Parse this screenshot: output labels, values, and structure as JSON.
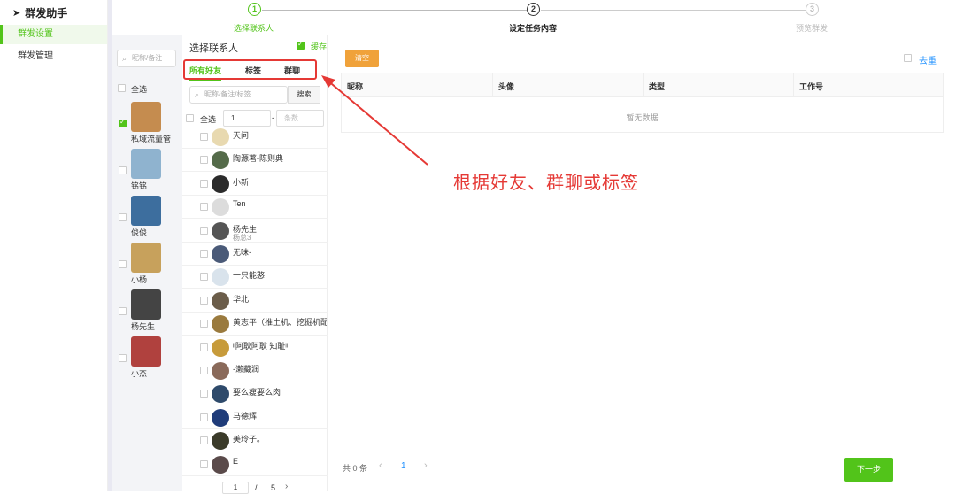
{
  "app_title": "群发助手",
  "nav": [
    {
      "label": "群发设置",
      "active": true
    },
    {
      "label": "群发管理",
      "active": false
    }
  ],
  "steps": [
    {
      "num": "1",
      "label": "选择联系人",
      "state": "active"
    },
    {
      "num": "2",
      "label": "设定任务内容",
      "state": "current"
    },
    {
      "num": "3",
      "label": "预览群发",
      "state": "pending"
    }
  ],
  "accounts": {
    "search_placeholder": "昵称/备注",
    "select_all": "全选",
    "items": [
      {
        "name": "私域流量管",
        "checked": true,
        "color": "#c58c4f"
      },
      {
        "name": "铭铭",
        "checked": false,
        "color": "#8fb3cf"
      },
      {
        "name": "俊俊",
        "checked": false,
        "color": "#3d6e9e"
      },
      {
        "name": "小杨",
        "checked": false,
        "color": "#c7a15c"
      },
      {
        "name": "杨先生",
        "checked": false,
        "color": "#444444"
      },
      {
        "name": "小杰",
        "checked": false,
        "color": "#b0413e"
      }
    ]
  },
  "contacts": {
    "header": "选择联系人",
    "cache_label": "缓存",
    "tabs": [
      "所有好友",
      "标签",
      "群聊"
    ],
    "search_placeholder": "昵称/备注/标签",
    "search_button": "搜索",
    "select_all": "全选",
    "range_from": "1",
    "range_to_placeholder": "条数",
    "range_sep": "-",
    "items": [
      {
        "name": "天问",
        "sub": "",
        "color": "#e8d9b0"
      },
      {
        "name": "陶源著-陈则典",
        "sub": "",
        "color": "#556b4a"
      },
      {
        "name": "小新",
        "sub": "",
        "color": "#2b2b2b"
      },
      {
        "name": "Ten",
        "sub": "",
        "color": "#dcdcdc"
      },
      {
        "name": "杨先生",
        "sub": "杨总3",
        "color": "#555555"
      },
      {
        "name": "无味-",
        "sub": "",
        "color": "#4a5a78"
      },
      {
        "name": "一只能憨",
        "sub": "",
        "color": "#d9e3ec"
      },
      {
        "name": "华北",
        "sub": "",
        "color": "#6b5d4a"
      },
      {
        "name": "黄志平（推土机、挖掘机配",
        "sub": "",
        "color": "#9a7a3e"
      },
      {
        "name": "ᵎᵎ阿耿阿耿 知耻ᵎᵎ",
        "sub": "",
        "color": "#c79b3b"
      },
      {
        "name": "-濑藏润",
        "sub": "",
        "color": "#8a6a5a"
      },
      {
        "name": "要么瘦要么肉",
        "sub": "",
        "color": "#2e4a6b"
      },
      {
        "name": "马德辉",
        "sub": "",
        "color": "#1f3c7a"
      },
      {
        "name": "美玲子。",
        "sub": "",
        "color": "#3b3b2a"
      },
      {
        "name": "E",
        "sub": "",
        "color": "#5a4a4a"
      }
    ],
    "page_current": "1",
    "page_sep": "/",
    "page_total": "5"
  },
  "right": {
    "clear_button": "清空",
    "dedupe_label": "去重",
    "columns": [
      "昵称",
      "头像",
      "类型",
      "工作号"
    ],
    "empty_text": "暂无数据",
    "total_text": "共 0 条",
    "page_prev": "‹",
    "page_current": "1",
    "page_next": "›",
    "next_button": "下一步"
  },
  "annotation": "根据好友、群聊或标签",
  "colors": {
    "accent": "#52c41a",
    "orange": "#f0a23a",
    "annotation": "#e53935"
  }
}
